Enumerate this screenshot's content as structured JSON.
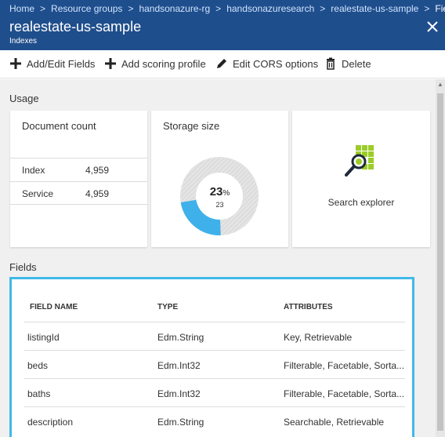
{
  "breadcrumb": {
    "items": [
      "Home",
      "Resource groups",
      "handsonazure-rg",
      "handsonazuresearch",
      "realestate-us-sample"
    ],
    "current": "Fields"
  },
  "header": {
    "title": "realestate-us-sample",
    "subtitle": "Indexes"
  },
  "toolbar": {
    "add_edit_fields": "Add/Edit Fields",
    "add_scoring_profile": "Add scoring profile",
    "edit_cors": "Edit CORS options",
    "delete": "Delete"
  },
  "usage": {
    "label": "Usage",
    "document_count": {
      "title": "Document count",
      "rows": [
        {
          "label": "Index",
          "value": "4,959"
        },
        {
          "label": "Service",
          "value": "4,959"
        }
      ]
    },
    "storage": {
      "title": "Storage size",
      "percent": "23",
      "percent_unit": "%",
      "sub": "23",
      "fraction": 0.23
    },
    "search_explorer": "Search explorer"
  },
  "fields": {
    "label": "Fields",
    "columns": [
      "FIELD NAME",
      "TYPE",
      "ATTRIBUTES"
    ],
    "rows": [
      {
        "name": "listingId",
        "type": "Edm.String",
        "attributes": "Key, Retrievable"
      },
      {
        "name": "beds",
        "type": "Edm.Int32",
        "attributes": "Filterable, Facetable, Sorta..."
      },
      {
        "name": "baths",
        "type": "Edm.Int32",
        "attributes": "Filterable, Facetable, Sorta..."
      },
      {
        "name": "description",
        "type": "Edm.String",
        "attributes": "Searchable, Retrievable"
      }
    ]
  },
  "colors": {
    "header_bg": "#1f4e8c",
    "accent": "#40b9e8",
    "donut_fill": "#3fb1ea",
    "donut_track": "#e0e0e0"
  }
}
